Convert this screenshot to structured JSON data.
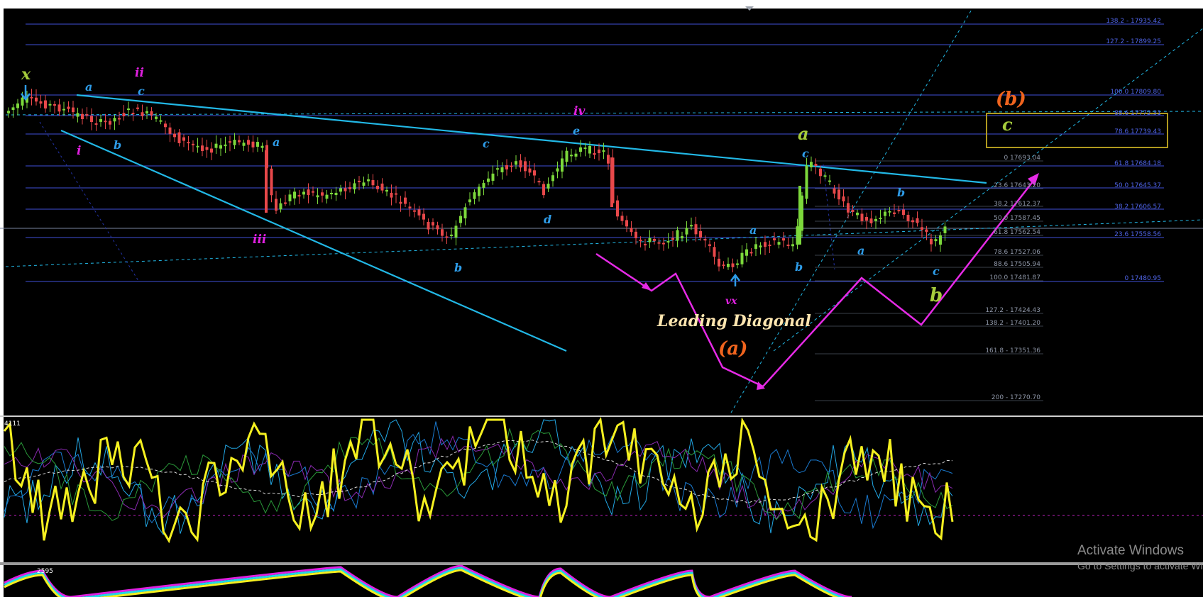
{
  "chart_data": {
    "type": "candlestick",
    "colors": {
      "background": "#000000",
      "bull": "#7CD83B",
      "bear": "#E8484A",
      "fib_lines": "#3F4FD8",
      "fib_label": "#4F64E6",
      "fib_label_right": "#8f97a8",
      "trendline": "#22B8E6",
      "projection": "#E62AE6",
      "wave_orange": "#F0641E",
      "wave_green": "#A6CC3C",
      "wave_blue": "#2E9CE8",
      "wave_magenta": "#E020E0",
      "oscillator_main": "#F5F020",
      "box": "#B09A1E"
    },
    "fib_levels_left": [
      "138.2 - 17935.42",
      "127.2 - 17899.25",
      "100.0 17809.80",
      "88.6 17772.31",
      "78.6 17739.43",
      "61.8 17684.18",
      "50.0 17645.37",
      "38.2 17606.57",
      "23.6 17558.56",
      "0 17480.95"
    ],
    "fib_levels_right": [
      "0 17693.04",
      "23.6 17643.20",
      "38.2 17612.37",
      "50.0 17587.45",
      "61.8 17562.54",
      "78.6 17527.06",
      "88.6 17505.94",
      "100.0 17481.87",
      "127.2 - 17424.43",
      "138.2 - 17401.20",
      "161.8 - 17351.36",
      "200 - 17270.70"
    ],
    "wave_labels": {
      "x": "x",
      "i": "i",
      "ii": "ii",
      "iii": "iii",
      "iv": "iv",
      "vx": "vx",
      "a": "a",
      "b": "b",
      "c": "c",
      "d": "d",
      "e": "e",
      "wave_a": "(a)",
      "wave_b": "(b)"
    },
    "annotation": "Leading Diagonal",
    "indicator1_value": "4111",
    "indicator2_value": "2595"
  },
  "watermark": {
    "line1": "Activate Windows",
    "line2": "Go to Settings to activate Windows."
  }
}
